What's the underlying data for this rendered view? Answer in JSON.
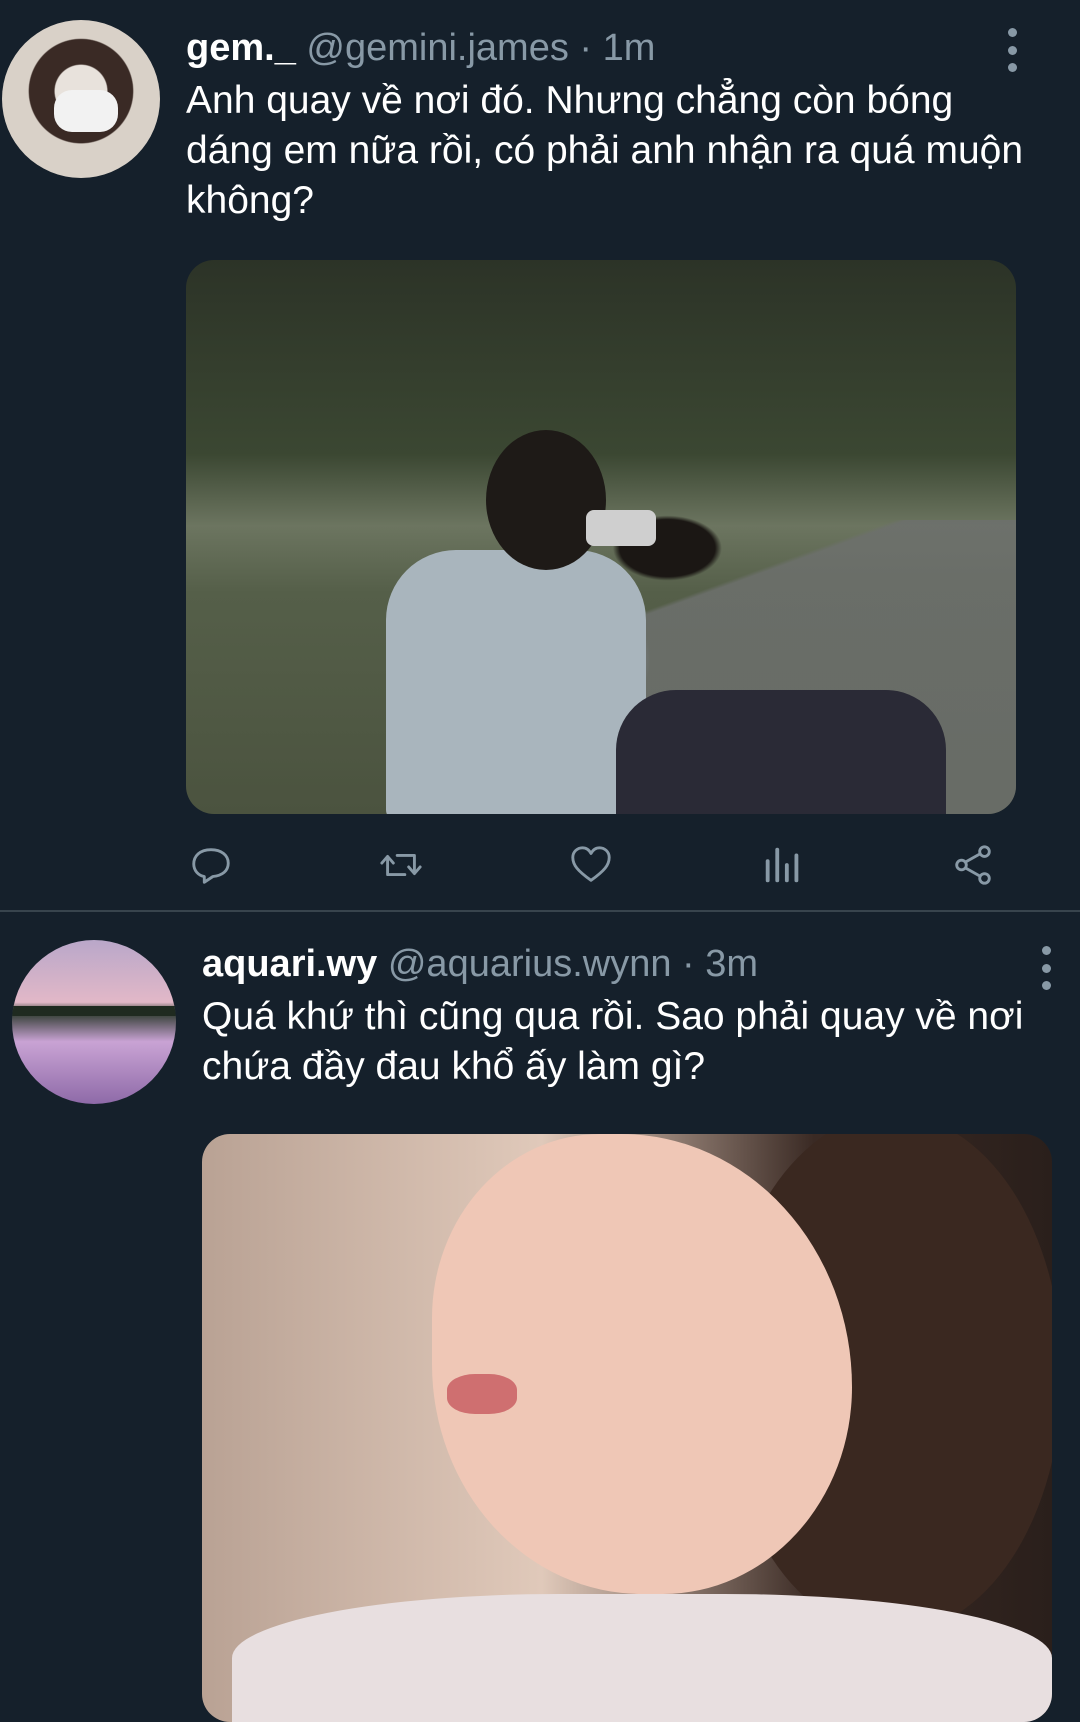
{
  "tweets": [
    {
      "display_name": "gem._",
      "handle": "@gemini.james",
      "separator": "·",
      "time": "1m",
      "text": "Anh quay về nơi đó. Nhưng chẳng còn bóng dáng em nữa rồi, có phải anh nhận ra quá muộn không?",
      "media": "photo-young-man-with-camera-in-park",
      "actions": [
        "reply-icon",
        "retweet-icon",
        "like-icon",
        "analytics-icon",
        "share-icon"
      ]
    },
    {
      "display_name": "aquari.wy",
      "handle": "@aquarius.wynn",
      "separator": "·",
      "time": "3m",
      "text": "Quá khứ thì cũng qua rồi. Sao phải quay về nơi chứa đầy đau khổ ấy làm gì?",
      "media": "photo-girl-profile-closeup"
    }
  ],
  "colors": {
    "background": "#15202b",
    "divider": "#38444d",
    "secondary_text": "#8899a6",
    "primary_text": "#ffffff",
    "icon": "#8899a6"
  }
}
